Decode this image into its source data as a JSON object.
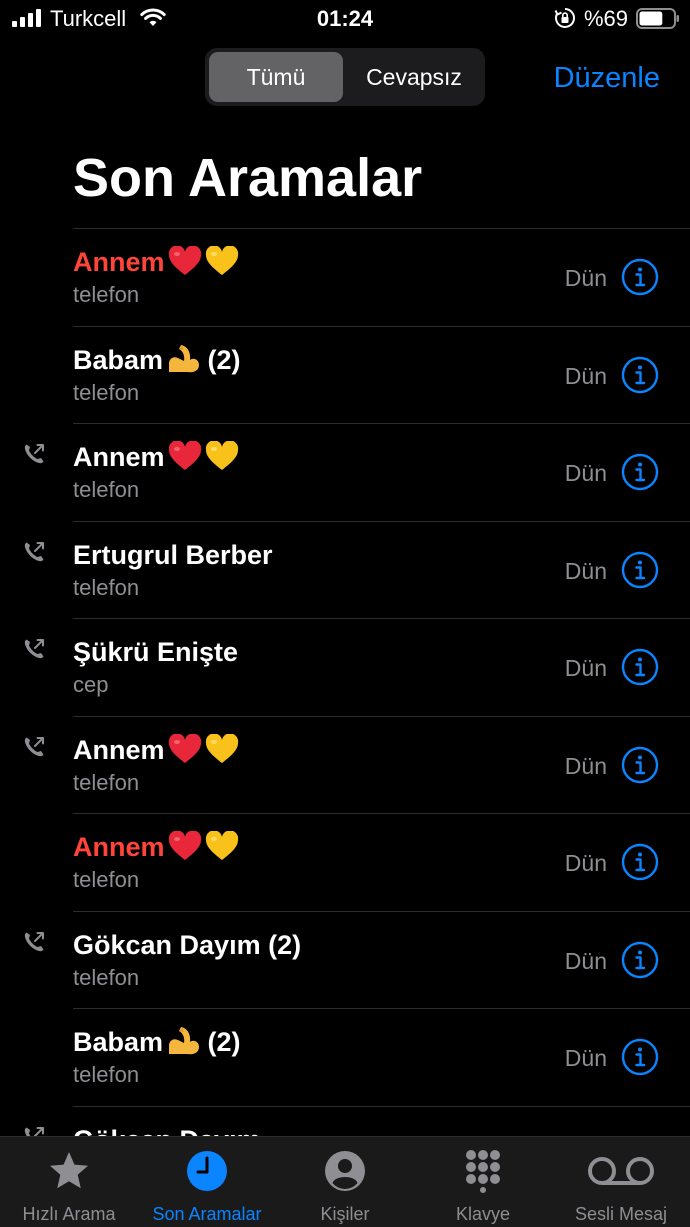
{
  "status_bar": {
    "carrier": "Turkcell",
    "time": "01:24",
    "battery_text": "%69",
    "battery_level": 0.69
  },
  "segment": {
    "all_label": "Tümü",
    "missed_label": "Cevapsız",
    "selected": "all"
  },
  "header": {
    "edit_label": "Düzenle",
    "title": "Son Aramalar"
  },
  "calls": [
    {
      "name": "Annem",
      "emoji": [
        "red-heart",
        "yellow-heart"
      ],
      "count": "",
      "type": "telefon",
      "date": "Dün",
      "missed": true,
      "outgoing": false
    },
    {
      "name": "Babam",
      "emoji": [
        "flexed-biceps"
      ],
      "count": "(2)",
      "type": "telefon",
      "date": "Dün",
      "missed": false,
      "outgoing": false
    },
    {
      "name": "Annem",
      "emoji": [
        "red-heart",
        "yellow-heart"
      ],
      "count": "",
      "type": "telefon",
      "date": "Dün",
      "missed": false,
      "outgoing": true
    },
    {
      "name": "Ertugrul Berber",
      "emoji": [],
      "count": "",
      "type": "telefon",
      "date": "Dün",
      "missed": false,
      "outgoing": true
    },
    {
      "name": "Şükrü Enişte",
      "emoji": [],
      "count": "",
      "type": "cep",
      "date": "Dün",
      "missed": false,
      "outgoing": true
    },
    {
      "name": "Annem",
      "emoji": [
        "red-heart",
        "yellow-heart"
      ],
      "count": "",
      "type": "telefon",
      "date": "Dün",
      "missed": false,
      "outgoing": true
    },
    {
      "name": "Annem",
      "emoji": [
        "red-heart",
        "yellow-heart"
      ],
      "count": "",
      "type": "telefon",
      "date": "Dün",
      "missed": true,
      "outgoing": false
    },
    {
      "name": "Gökcan Dayım",
      "emoji": [],
      "count": "(2)",
      "type": "telefon",
      "date": "Dün",
      "missed": false,
      "outgoing": true
    },
    {
      "name": "Babam",
      "emoji": [
        "flexed-biceps"
      ],
      "count": "(2)",
      "type": "telefon",
      "date": "Dün",
      "missed": false,
      "outgoing": false
    },
    {
      "name": "Gökcan Dayım",
      "emoji": [],
      "count": "",
      "type": "",
      "date": "",
      "missed": false,
      "outgoing": true
    }
  ],
  "tabs": [
    {
      "id": "favorites",
      "label": "Hızlı Arama",
      "icon": "star-icon",
      "active": false
    },
    {
      "id": "recents",
      "label": "Son Aramalar",
      "icon": "clock-icon",
      "active": true
    },
    {
      "id": "contacts",
      "label": "Kişiler",
      "icon": "person-icon",
      "active": false
    },
    {
      "id": "keypad",
      "label": "Klavye",
      "icon": "keypad-icon",
      "active": false
    },
    {
      "id": "voicemail",
      "label": "Sesli Mesaj",
      "icon": "voicemail-icon",
      "active": false
    }
  ],
  "colors": {
    "accent": "#0a84ff",
    "missed": "#ff453a",
    "secondary_text": "#8e8e93",
    "segment_bg": "#1c1c1e",
    "segment_selected": "#636366",
    "tab_bar_bg": "#1a1a1a"
  }
}
